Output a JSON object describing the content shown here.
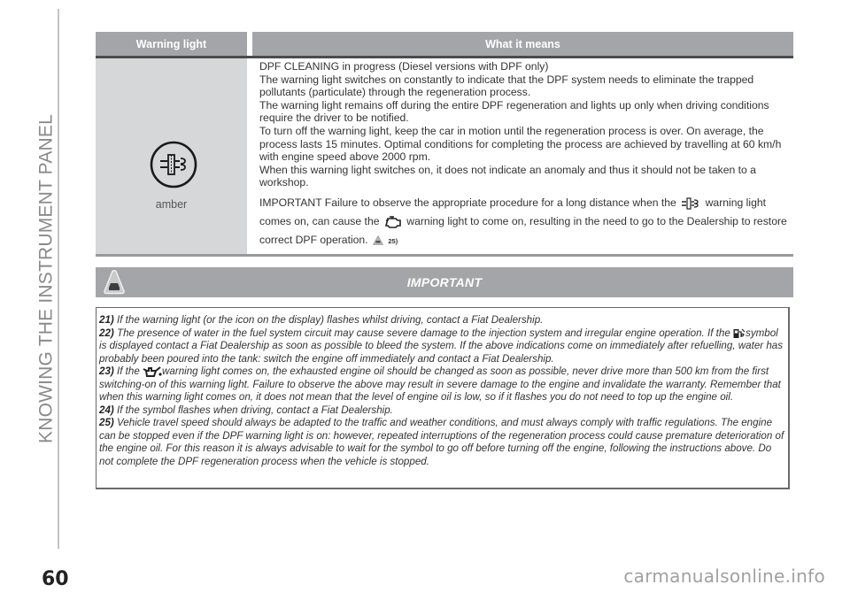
{
  "page": {
    "section_title": "KNOWING THE INSTRUMENT PANEL",
    "page_number": "60",
    "watermark": "carmanualsonline.info"
  },
  "table": {
    "headers": [
      "Warning light",
      "What it means"
    ],
    "rows": [
      {
        "icon": "dpf-warning-icon",
        "color_label": "amber",
        "paragraphs": [
          "DPF CLEANING in progress (Diesel versions with DPF only)",
          "The warning light switches on constantly to indicate that the DPF system needs to eliminate the trapped pollutants (particulate) through the regeneration process.",
          "The warning light remains off during the entire DPF regeneration and lights up only when driving conditions require the driver to be notified.",
          "To turn off the warning light, keep the car in motion until the regeneration process is over. On average, the process lasts 15 minutes. Optimal conditions for completing the process are achieved by travelling at 60 km/h with engine speed above 2000 rpm.",
          "When this warning light switches on, it does not indicate an anomaly and thus it should not be taken to a workshop."
        ],
        "important": {
          "part1": "IMPORTANT Failure to observe the appropriate procedure for a long distance when the",
          "part2": "warning light comes on, can cause the",
          "part3": "warning light to come on, resulting in the need to go to the Dealership to restore correct DPF operation.",
          "ref": "25)"
        }
      }
    ]
  },
  "important_box": {
    "title": "IMPORTANT",
    "notes": [
      {
        "num": "21)",
        "text": "If the warning light (or the icon on the display) flashes whilst driving, contact a Fiat Dealership."
      },
      {
        "num": "22)",
        "text_a": "The presence of water in the fuel system circuit may cause severe damage to the injection system and irregular engine operation. If the",
        "text_b": "symbol is displayed contact a Fiat Dealership as soon as possible to bleed the system. If the above indications come on immediately after refuelling, water has probably been poured into the tank: switch the engine off immediately and contact a Fiat Dealership."
      },
      {
        "num": "23)",
        "text_a": "If the",
        "text_b": "warning light comes on, the exhausted engine oil should be changed as soon as possible, never drive more than 500 km from the first switching-on of this warning light. Failure to observe the above may result in severe damage to the engine and invalidate the warranty. Remember that when this warning light comes on, it does not mean that the level of engine oil is low, so if it flashes you do not need to top up the engine oil."
      },
      {
        "num": "24)",
        "text": "If the symbol flashes when driving, contact a Fiat Dealership."
      },
      {
        "num": "25)",
        "text": "Vehicle travel speed should always be adapted to the traffic and weather conditions, and must always comply with traffic regulations. The engine can be stopped even if the DPF warning light is on: however, repeated interruptions of the regeneration process could cause premature deterioration of the engine oil. For this reason it is always advisable to wait for the symbol to go off before turning off the engine, following the instructions above. Do not complete the DPF regeneration process when the vehicle is stopped."
      }
    ]
  }
}
